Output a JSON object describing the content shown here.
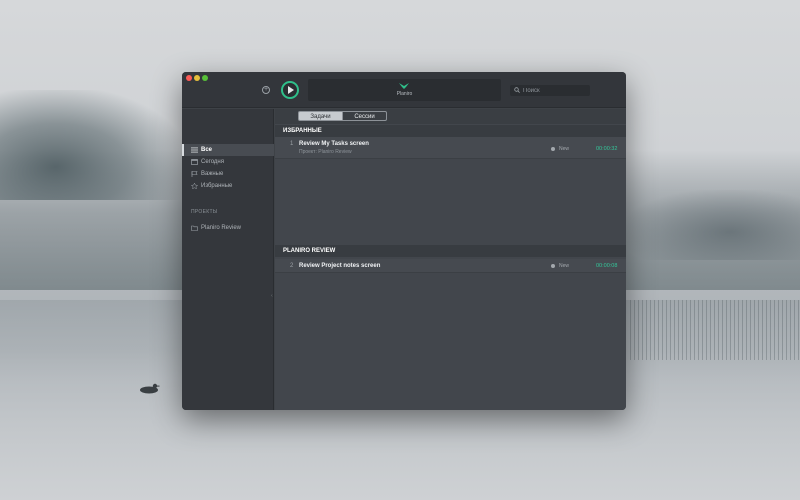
{
  "window": {
    "brand_name": "Planiro"
  },
  "search": {
    "placeholder": "Поиск"
  },
  "sidebar": {
    "items": [
      {
        "label": "Все",
        "icon": "list-icon",
        "active": true
      },
      {
        "label": "Сегодня",
        "icon": "calendar-icon",
        "active": false
      },
      {
        "label": "Важные",
        "icon": "flag-icon",
        "active": false
      },
      {
        "label": "Избранные",
        "icon": "star-icon",
        "active": false
      }
    ],
    "projects_header": "ПРОЕКТЫ",
    "projects": [
      {
        "label": "Planiro Review",
        "icon": "folder-icon"
      }
    ]
  },
  "tabs": [
    {
      "label": "Задачи",
      "active": true
    },
    {
      "label": "Сессии",
      "active": false
    }
  ],
  "groups": [
    {
      "title": "ИЗБРАННЫЕ",
      "tasks": [
        {
          "num": "1",
          "title": "Review My Tasks screen",
          "project": "Проект: Planiro Review",
          "status": "New",
          "time": "00:00:32"
        }
      ]
    },
    {
      "title": "PLANIRO REVIEW",
      "tasks": [
        {
          "num": "2",
          "title": "Review Project notes screen",
          "project": "",
          "status": "New",
          "time": "00:00:08"
        }
      ]
    }
  ],
  "colors": {
    "accent": "#34c79a",
    "play_ring": "#2fbf8a"
  }
}
